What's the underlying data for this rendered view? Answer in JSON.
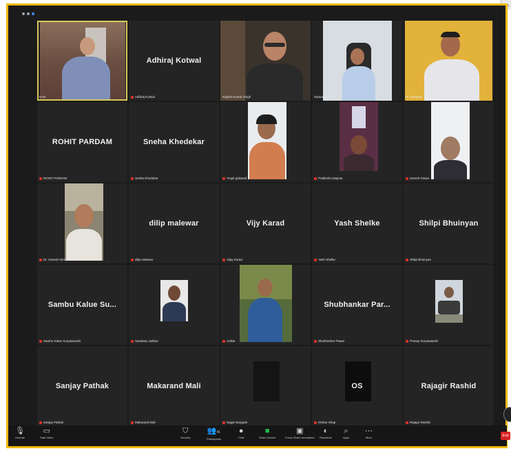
{
  "colors": {
    "frame_border": "#f2b90c",
    "background": "#1b1b1b",
    "tile": "#242424",
    "mute": "#d6322b",
    "end_button": "#d92424",
    "share_green": "#1fbf52"
  },
  "tiles": [
    {
      "center": "",
      "label": "Host",
      "muted": false,
      "video": true
    },
    {
      "center": "Adhiraj Kotwal",
      "label": "Adhiraj Kotwal",
      "muted": true,
      "video": false
    },
    {
      "center": "",
      "label": "Rajesh Kumar Singh",
      "muted": false,
      "video": true
    },
    {
      "center": "",
      "label": "Santosh Pandit",
      "muted": false,
      "video": true
    },
    {
      "center": "",
      "label": "Dr. Bhagwat",
      "muted": false,
      "video": true
    },
    {
      "center": "ROHIT PARDAM",
      "label": "ROHIT PARDAM",
      "muted": true,
      "video": false
    },
    {
      "center": "Sneha Khedekar",
      "label": "Sneha Khedekar",
      "muted": true,
      "video": false
    },
    {
      "center": "",
      "label": "Trupti gaikwad",
      "muted": true,
      "video": true
    },
    {
      "center": "",
      "label": "Pratiksha Satpute",
      "muted": true,
      "video": true
    },
    {
      "center": "",
      "label": "Suresh Pawar",
      "muted": true,
      "video": true
    },
    {
      "center": "",
      "label": "Dr. Ganesh DHOLE PATIL",
      "muted": true,
      "video": true
    },
    {
      "center": "dilip malewar",
      "label": "dilip malewar",
      "muted": true,
      "video": false
    },
    {
      "center": "Vijy Karad",
      "label": "Vijay Karad",
      "muted": true,
      "video": false
    },
    {
      "center": "Yash Shelke",
      "label": "Yash Shelke",
      "muted": true,
      "video": false
    },
    {
      "center": "Shilpi Bhuinyan",
      "label": "Shilpi Bhuinyan",
      "muted": true,
      "video": false
    },
    {
      "center": "Sambu Kalue Su...",
      "label": "Sambu Kalue Suryawanshi",
      "muted": true,
      "video": false
    },
    {
      "center": "",
      "label": "Sandeep Jadhav",
      "muted": true,
      "video": true
    },
    {
      "center": "",
      "label": "Aniket",
      "muted": true,
      "video": true
    },
    {
      "center": "Shubhankar Par...",
      "label": "Shubhankar Pawar",
      "muted": true,
      "video": false
    },
    {
      "center": "",
      "label": "Pranay Suryawanshi",
      "muted": true,
      "video": true
    },
    {
      "center": "Sanjay Pathak",
      "label": "Sanjay Pathak",
      "muted": true,
      "video": false
    },
    {
      "center": "Makarand Mali",
      "label": "Makarand Mali",
      "muted": true,
      "video": false
    },
    {
      "center": "",
      "label": "Sagar Bargade",
      "muted": true,
      "video": true
    },
    {
      "center": "OS",
      "label": "Omkar Shap",
      "muted": true,
      "video": false
    },
    {
      "center": "Rajagir Rashid",
      "label": "Rajagir Rashid",
      "muted": true,
      "video": false
    }
  ],
  "toolbar": {
    "unmute": "Unmute",
    "start_video": "Start Video",
    "security": "Security",
    "participants": "Participants",
    "participants_count": "41",
    "chat": "Chat",
    "share_screen": "Share Screen",
    "polls": "Focus Share Annotation",
    "reactions": "Reactions",
    "apps": "Apps",
    "more": "More",
    "end": "End"
  }
}
